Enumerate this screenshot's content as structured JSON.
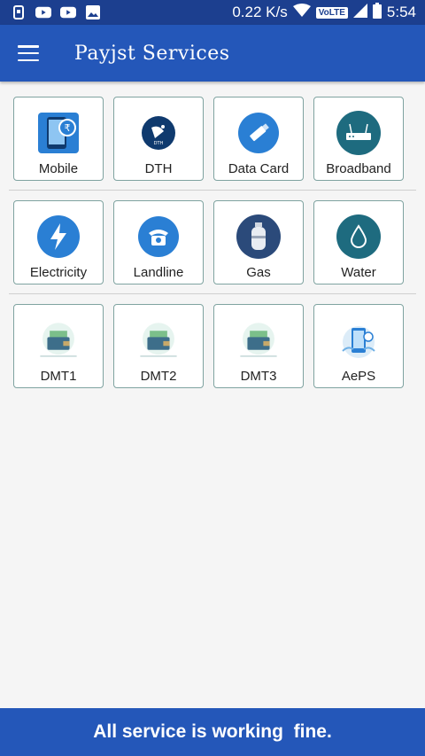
{
  "status_bar": {
    "speed": "0.22 K/s",
    "volte": "VoLTE",
    "time": "5:54",
    "icons": [
      "phone-notification-icon",
      "youtube-icon",
      "youtube-icon",
      "image-icon",
      "wifi-icon",
      "volte-icon",
      "signal-icon",
      "battery-icon"
    ]
  },
  "toolbar": {
    "title": "Payjst Services"
  },
  "services": {
    "row1": [
      {
        "label": "Mobile",
        "icon": "mobile-recharge-icon"
      },
      {
        "label": "DTH",
        "icon": "dth-dish-icon"
      },
      {
        "label": "Data Card",
        "icon": "usb-datacard-icon"
      },
      {
        "label": "Broadband",
        "icon": "router-icon"
      }
    ],
    "row2": [
      {
        "label": "Electricity",
        "icon": "lightning-icon"
      },
      {
        "label": "Landline",
        "icon": "telephone-icon"
      },
      {
        "label": "Gas",
        "icon": "gas-cylinder-icon"
      },
      {
        "label": "Water",
        "icon": "water-drop-icon"
      }
    ],
    "row3": [
      {
        "label": "DMT1",
        "icon": "money-wallet-icon"
      },
      {
        "label": "DMT2",
        "icon": "money-wallet-icon"
      },
      {
        "label": "DMT3",
        "icon": "money-wallet-icon"
      },
      {
        "label": "AePS",
        "icon": "aeps-fingerprint-icon"
      }
    ]
  },
  "footer": {
    "message": "All service is working  fine."
  },
  "colors": {
    "primary": "#2457b9",
    "status_bar": "#1c3f8f",
    "tile_border": "#7fa3a0",
    "icon_blue": "#2a7fd4",
    "icon_teal": "#1e6b7f"
  }
}
